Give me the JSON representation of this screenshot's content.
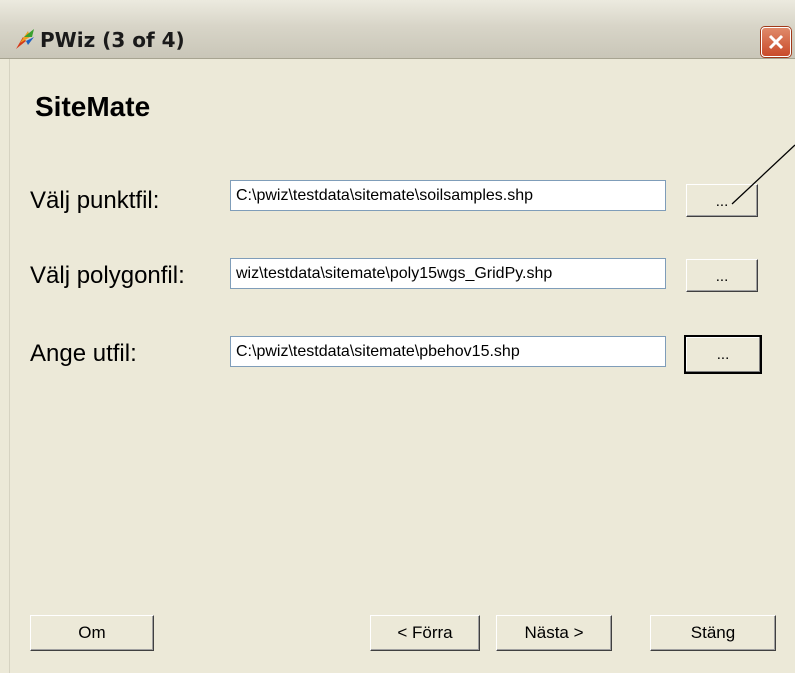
{
  "window": {
    "title": "PWiz (3 of 4)"
  },
  "page": {
    "heading": "SiteMate"
  },
  "rows": [
    {
      "label": "Välj punktfil:",
      "value": "C:\\pwiz\\testdata\\sitemate\\soilsamples.shp",
      "browse_label": "..."
    },
    {
      "label": "Välj polygonfil:",
      "value": "wiz\\testdata\\sitemate\\poly15wgs_GridPy.shp",
      "browse_label": "..."
    },
    {
      "label": "Ange utfil:",
      "value": "C:\\pwiz\\testdata\\sitemate\\pbehov15.shp",
      "browse_label": "..."
    }
  ],
  "buttons": {
    "about": "Om",
    "back": "< Förra",
    "next": "Nästa >",
    "close": "Stäng"
  },
  "icons": {
    "app": "pwiz-app-icon",
    "close": "close-icon"
  }
}
